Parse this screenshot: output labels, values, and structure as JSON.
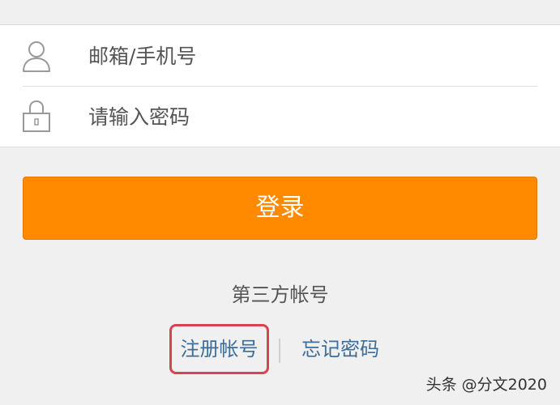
{
  "login_form": {
    "username": {
      "icon": "user-icon",
      "placeholder": "邮箱/手机号",
      "value": ""
    },
    "password": {
      "icon": "lock-icon",
      "placeholder": "请输入密码",
      "value": ""
    },
    "login_label": "登录"
  },
  "third_party": {
    "label": "第三方帐号"
  },
  "links": {
    "register_label": "注册帐号",
    "forgot_label": "忘记密码"
  },
  "watermark": {
    "text": "头条 @分文2020"
  },
  "colors": {
    "accent": "#ff8a00",
    "link": "#3b6e9a",
    "highlight": "#d9424f",
    "background": "#f0f0f0"
  }
}
